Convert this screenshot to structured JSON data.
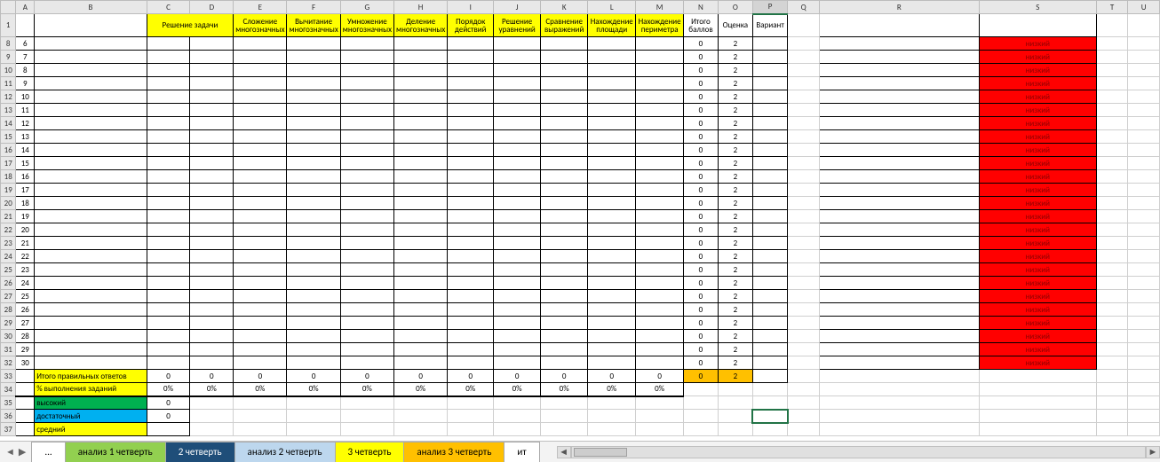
{
  "columns": [
    "A",
    "B",
    "C",
    "D",
    "E",
    "F",
    "G",
    "H",
    "I",
    "J",
    "K",
    "L",
    "M",
    "N",
    "O",
    "P",
    "Q",
    "R",
    "S",
    "T",
    "U"
  ],
  "headers": {
    "C": "Решение задачи",
    "E": "Сложение многозначных",
    "F": "Вычитание многозначных",
    "G": "Умножение многозначных",
    "H": "Деление многозначных",
    "I": "Порядок действий",
    "J": "Решение уравнений",
    "K": "Сравнение выражений",
    "L": "Нахождение площади",
    "M": "Нахождение периметра",
    "N": "Итого баллов",
    "O": "Оценка",
    "P": "Вариант"
  },
  "row_labels": [
    "8",
    "9",
    "10",
    "11",
    "12",
    "13",
    "14",
    "15",
    "16",
    "17",
    "18",
    "19",
    "20",
    "21",
    "22",
    "23",
    "24",
    "25",
    "26",
    "27",
    "28",
    "29",
    "30",
    "31",
    "32",
    "33",
    "34",
    "35",
    "36",
    "37"
  ],
  "body_rows": [
    {
      "a": "6",
      "n": "0",
      "o": "2",
      "s": "низкий"
    },
    {
      "a": "7",
      "n": "0",
      "o": "2",
      "s": "низкий"
    },
    {
      "a": "8",
      "n": "0",
      "o": "2",
      "s": "низкий"
    },
    {
      "a": "9",
      "n": "0",
      "o": "2",
      "s": "низкий"
    },
    {
      "a": "10",
      "n": "0",
      "o": "2",
      "s": "низкий"
    },
    {
      "a": "11",
      "n": "0",
      "o": "2",
      "s": "низкий"
    },
    {
      "a": "12",
      "n": "0",
      "o": "2",
      "s": "низкий"
    },
    {
      "a": "13",
      "n": "0",
      "o": "2",
      "s": "низкий"
    },
    {
      "a": "14",
      "n": "0",
      "o": "2",
      "s": "низкий"
    },
    {
      "a": "15",
      "n": "0",
      "o": "2",
      "s": "низкий"
    },
    {
      "a": "16",
      "n": "0",
      "o": "2",
      "s": "низкий"
    },
    {
      "a": "17",
      "n": "0",
      "o": "2",
      "s": "низкий"
    },
    {
      "a": "18",
      "n": "0",
      "o": "2",
      "s": "низкий"
    },
    {
      "a": "19",
      "n": "0",
      "o": "2",
      "s": "низкий"
    },
    {
      "a": "20",
      "n": "0",
      "o": "2",
      "s": "низкий"
    },
    {
      "a": "21",
      "n": "0",
      "o": "2",
      "s": "низкий"
    },
    {
      "a": "22",
      "n": "0",
      "o": "2",
      "s": "низкий"
    },
    {
      "a": "23",
      "n": "0",
      "o": "2",
      "s": "низкий"
    },
    {
      "a": "24",
      "n": "0",
      "o": "2",
      "s": "низкий"
    },
    {
      "a": "25",
      "n": "0",
      "o": "2",
      "s": "низкий"
    },
    {
      "a": "26",
      "n": "0",
      "o": "2",
      "s": "низкий"
    },
    {
      "a": "27",
      "n": "0",
      "o": "2",
      "s": "низкий"
    },
    {
      "a": "28",
      "n": "0",
      "o": "2",
      "s": "низкий"
    },
    {
      "a": "29",
      "n": "0",
      "o": "2",
      "s": "низкий"
    },
    {
      "a": "30",
      "n": "0",
      "o": "2",
      "s": "низкий"
    }
  ],
  "summary": {
    "row33_label": "Итого правильных ответов",
    "row33_vals": [
      "0",
      "0",
      "0",
      "0",
      "0",
      "0",
      "0",
      "0",
      "0",
      "0",
      "0"
    ],
    "row33_n": "0",
    "row33_o": "2",
    "row34_label": "% выполнения заданий",
    "row34_vals": [
      "0%",
      "0%",
      "0%",
      "0%",
      "0%",
      "0%",
      "0%",
      "0%",
      "0%",
      "0%",
      "0%"
    ],
    "row35_label": "высокий",
    "row35_val": "0",
    "row36_label": "достаточный",
    "row36_val": "0",
    "row37_label": "средний"
  },
  "tabs": {
    "more": "...",
    "t1": "анализ  1 четверть",
    "t2": "2 четверть",
    "t3": "анализ 2 четверть",
    "t4": "3 четверть",
    "t5": "анализ 3 четверть",
    "t6": "ит"
  }
}
